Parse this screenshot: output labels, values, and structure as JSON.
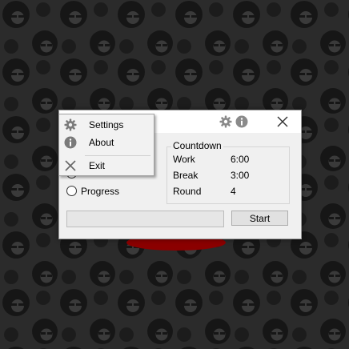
{
  "context_menu": {
    "items": [
      {
        "label": "Settings",
        "icon": "gear-icon"
      },
      {
        "label": "About",
        "icon": "info-icon"
      },
      {
        "label": "Exit",
        "icon": "close-icon"
      }
    ]
  },
  "window": {
    "titlebar_icons": [
      "gear-icon",
      "info-icon",
      "close-icon"
    ],
    "progress_label": "Progress",
    "countdown": {
      "title": "Countdown",
      "rows": [
        {
          "label": "Work",
          "value": "6:00"
        },
        {
          "label": "Break",
          "value": "3:00"
        },
        {
          "label": "Round",
          "value": "4"
        }
      ]
    },
    "start_label": "Start"
  },
  "colors": {
    "wallpaper": "#2b2b2b",
    "window_bg": "#f0f0f0",
    "accent_red": "#8b0000"
  }
}
